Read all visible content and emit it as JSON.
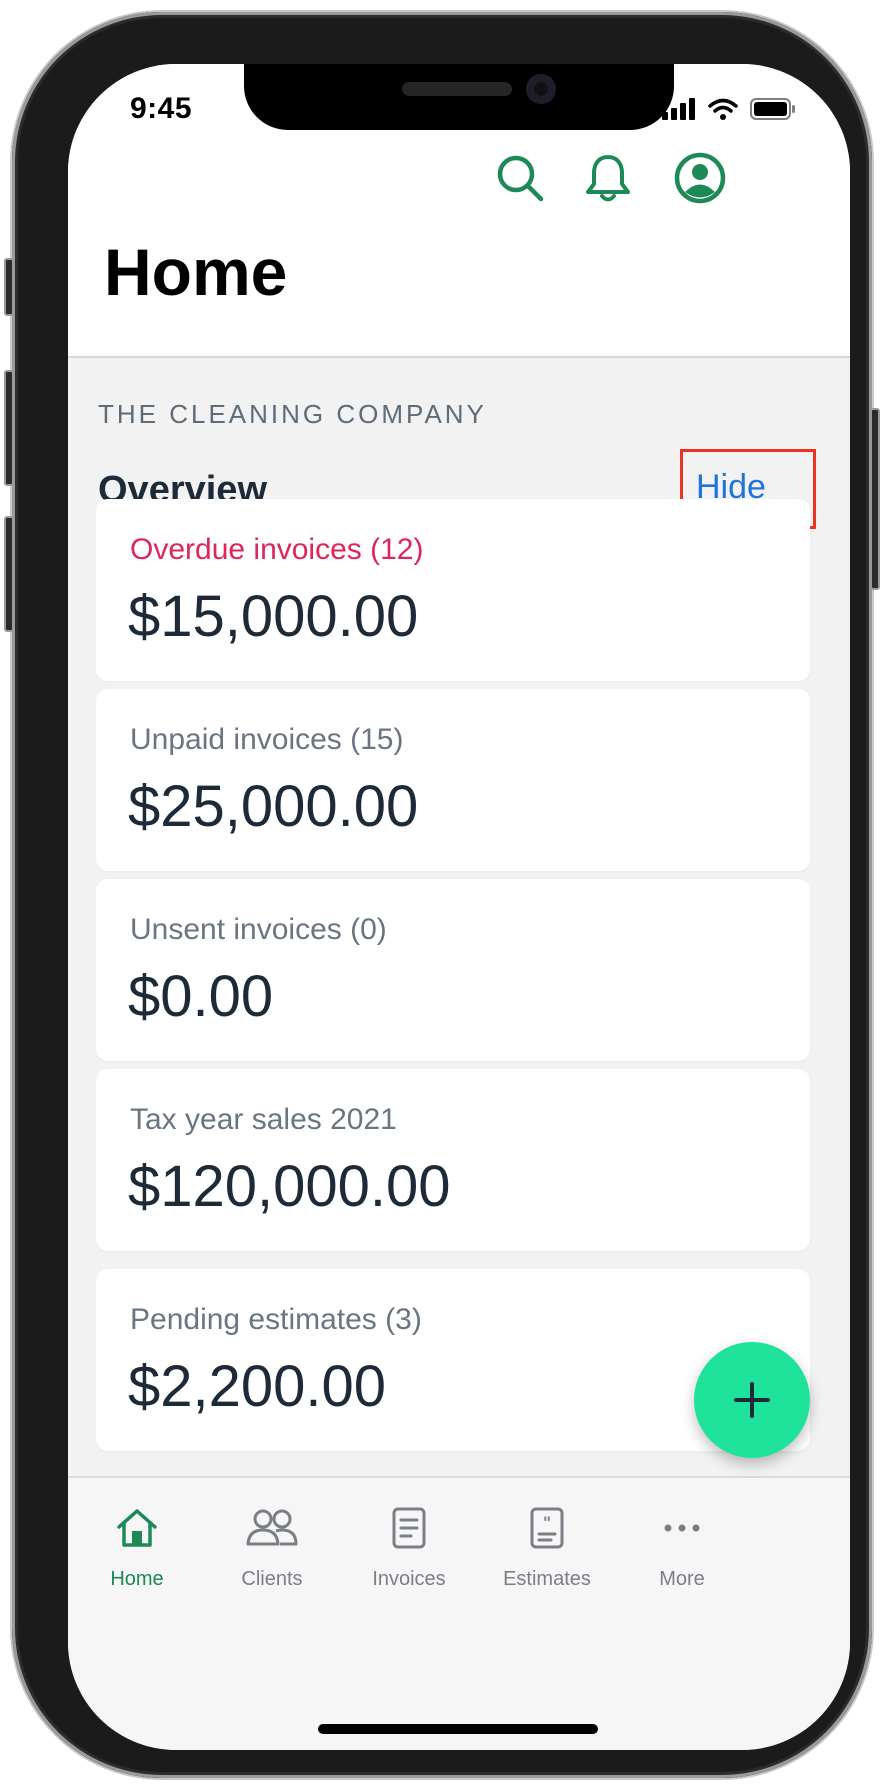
{
  "status_bar": {
    "time": "9:45"
  },
  "header": {
    "title": "Home",
    "icons": [
      "search-icon",
      "bell-icon",
      "account-icon"
    ]
  },
  "company_name": "THE CLEANING COMPANY",
  "overview": {
    "title": "Overview",
    "hide_label": "Hide",
    "cards": [
      {
        "label": "Overdue invoices (12)",
        "value": "$15,000.00",
        "accent": "#e0245e"
      },
      {
        "label": "Unpaid invoices (15)",
        "value": "$25,000.00"
      },
      {
        "label": "Unsent invoices (0)",
        "value": "$0.00"
      },
      {
        "label": "Tax year sales 2021",
        "value": "$120,000.00"
      },
      {
        "label": "Pending estimates (3)",
        "value": "$2,200.00"
      }
    ]
  },
  "fab": {
    "icon": "plus-icon",
    "color": "#1fe39a"
  },
  "tabbar": {
    "items": [
      {
        "label": "Home",
        "icon": "home-icon",
        "active": true
      },
      {
        "label": "Clients",
        "icon": "clients-icon"
      },
      {
        "label": "Invoices",
        "icon": "invoice-icon"
      },
      {
        "label": "Estimates",
        "icon": "estimate-icon"
      },
      {
        "label": "More",
        "icon": "more-icon"
      }
    ]
  },
  "colors": {
    "brand_green": "#1d8a55",
    "link_blue": "#1f74d9",
    "highlight_red": "#ea3323"
  }
}
